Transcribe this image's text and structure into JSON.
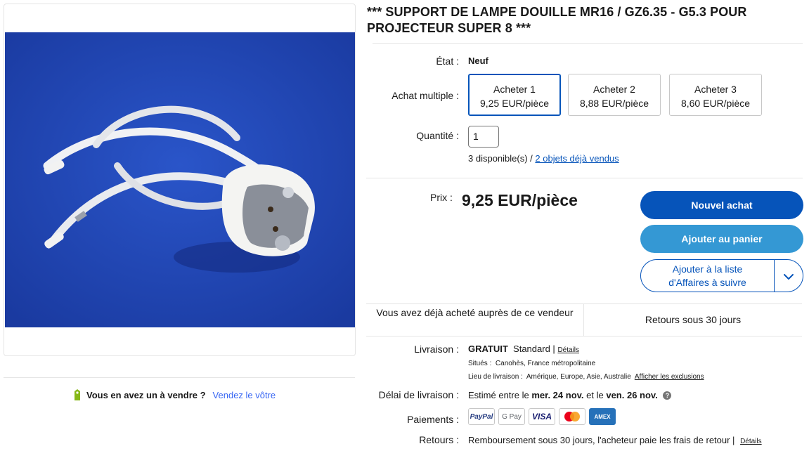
{
  "product": {
    "title": "*** SUPPORT DE LAMPE DOUILLE MR16 / GZ6.35 - G5.3 POUR PROJECTEUR SUPER 8 ***",
    "image_alt": "lamp-socket-photo"
  },
  "sell": {
    "question": "Vous en avez un à vendre ?",
    "link": "Vendez le vôtre"
  },
  "condition": {
    "label": "État :",
    "value": "Neuf"
  },
  "multi_buy": {
    "label": "Achat multiple :",
    "options": [
      {
        "title": "Acheter 1",
        "price": "9,25 EUR/pièce",
        "selected": true
      },
      {
        "title": "Acheter 2",
        "price": "8,88 EUR/pièce",
        "selected": false
      },
      {
        "title": "Acheter 3",
        "price": "8,60 EUR/pièce",
        "selected": false
      }
    ]
  },
  "quantity": {
    "label": "Quantité :",
    "value": "1",
    "available": "3 disponible(s) /",
    "sold_link": "2 objets déjà vendus"
  },
  "price": {
    "label": "Prix :",
    "value": "9,25 EUR/pièce"
  },
  "buttons": {
    "buy_now": "Nouvel achat",
    "add_to_cart": "Ajouter au panier",
    "watch_line1": "Ajouter à la liste",
    "watch_line2": "d'Affaires à suivre"
  },
  "info": {
    "left": "Vous avez déjà acheté auprès de ce vendeur",
    "right": "Retours sous 30 jours"
  },
  "shipping": {
    "label": "Livraison :",
    "free": "GRATUIT",
    "method": "Standard |",
    "details": "Détails",
    "location_label": "Situés :",
    "location": "Canohès, France métropolitaine",
    "ship_to_label": "Lieu de livraison :",
    "ship_to": "Amérique, Europe, Asie, Australie",
    "exclusions": "Afficher les exclusions"
  },
  "delivery": {
    "label": "Délai de livraison :",
    "prefix": "Estimé entre le",
    "date1": "mer. 24 nov.",
    "mid": "et le",
    "date2": "ven. 26 nov."
  },
  "payments": {
    "label": "Paiements :",
    "methods": [
      "PayPal",
      "G Pay",
      "VISA",
      "Mastercard",
      "AMEX"
    ]
  },
  "returns": {
    "label": "Retours :",
    "text": "Remboursement sous 30 jours, l'acheteur paie les frais de retour |",
    "details": "Détails"
  },
  "colors": {
    "primary": "#0654ba",
    "cart": "#3498d4",
    "photo_bg": "#1f45b4"
  }
}
